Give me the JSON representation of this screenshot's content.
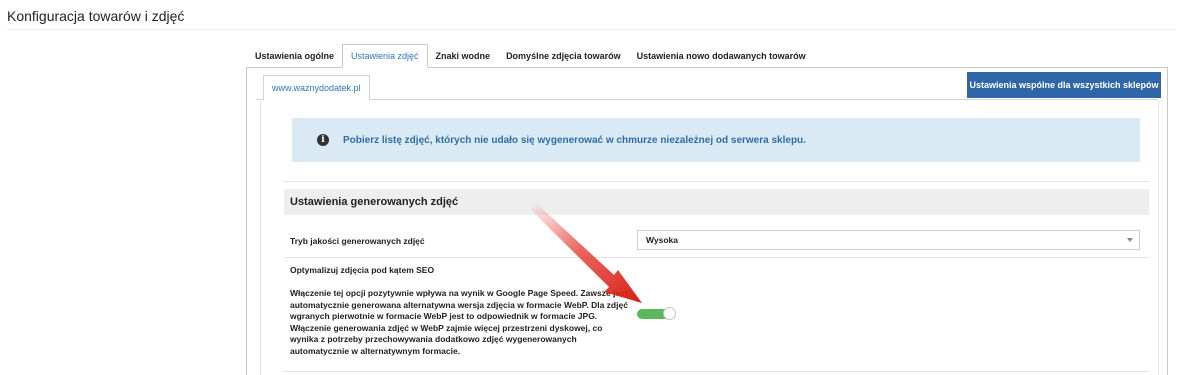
{
  "page": {
    "title": "Konfiguracja towarów i zdjęć"
  },
  "tabs": [
    {
      "label": "Ustawienia ogólne",
      "active": false
    },
    {
      "label": "Ustawienia zdjęć",
      "active": true
    },
    {
      "label": "Znaki wodne",
      "active": false
    },
    {
      "label": "Domyślne zdjęcia towarów",
      "active": false
    },
    {
      "label": "Ustawienia nowo dodawanych towarów",
      "active": false
    }
  ],
  "store": {
    "tab_label": "www.waznydodatek.pl",
    "common_button": "Ustawienia wspólne dla wszystkich sklepów"
  },
  "info": {
    "icon": "info-circle-icon",
    "text": "Pobierz listę zdjęć, których nie udało się wygenerować w chmurze niezależnej od serwera sklepu."
  },
  "section": {
    "title": "Ustawienia generowanych zdjęć",
    "quality": {
      "label": "Tryb jakości generowanych zdjęć",
      "value": "Wysoka"
    },
    "seo": {
      "label": "Optymalizuj zdjęcia pod kątem SEO",
      "description": "Włączenie tej opcji pozytywnie wpływa na wynik w Google Page Speed. Zawsze jest automatycznie generowana alternatywna wersja zdjęcia w formacie WebP. Dla zdjęć wgranych pierwotnie w formacie WebP jest to odpowiednik w formacie JPG. Włączenie generowania zdjęć w WebP zajmie więcej przestrzeni dyskowej, co wynika z potrzeby przechowywania dodatkowo zdjęć wygenerowanych automatycznie w alternatywnym formacie.",
      "enabled": true
    }
  },
  "colors": {
    "accent": "#2f66aa",
    "tab_active": "#2b78c2",
    "info_bg": "#d9eaf5",
    "toggle_on": "#5cb85c",
    "arrow": "#e0261b"
  }
}
